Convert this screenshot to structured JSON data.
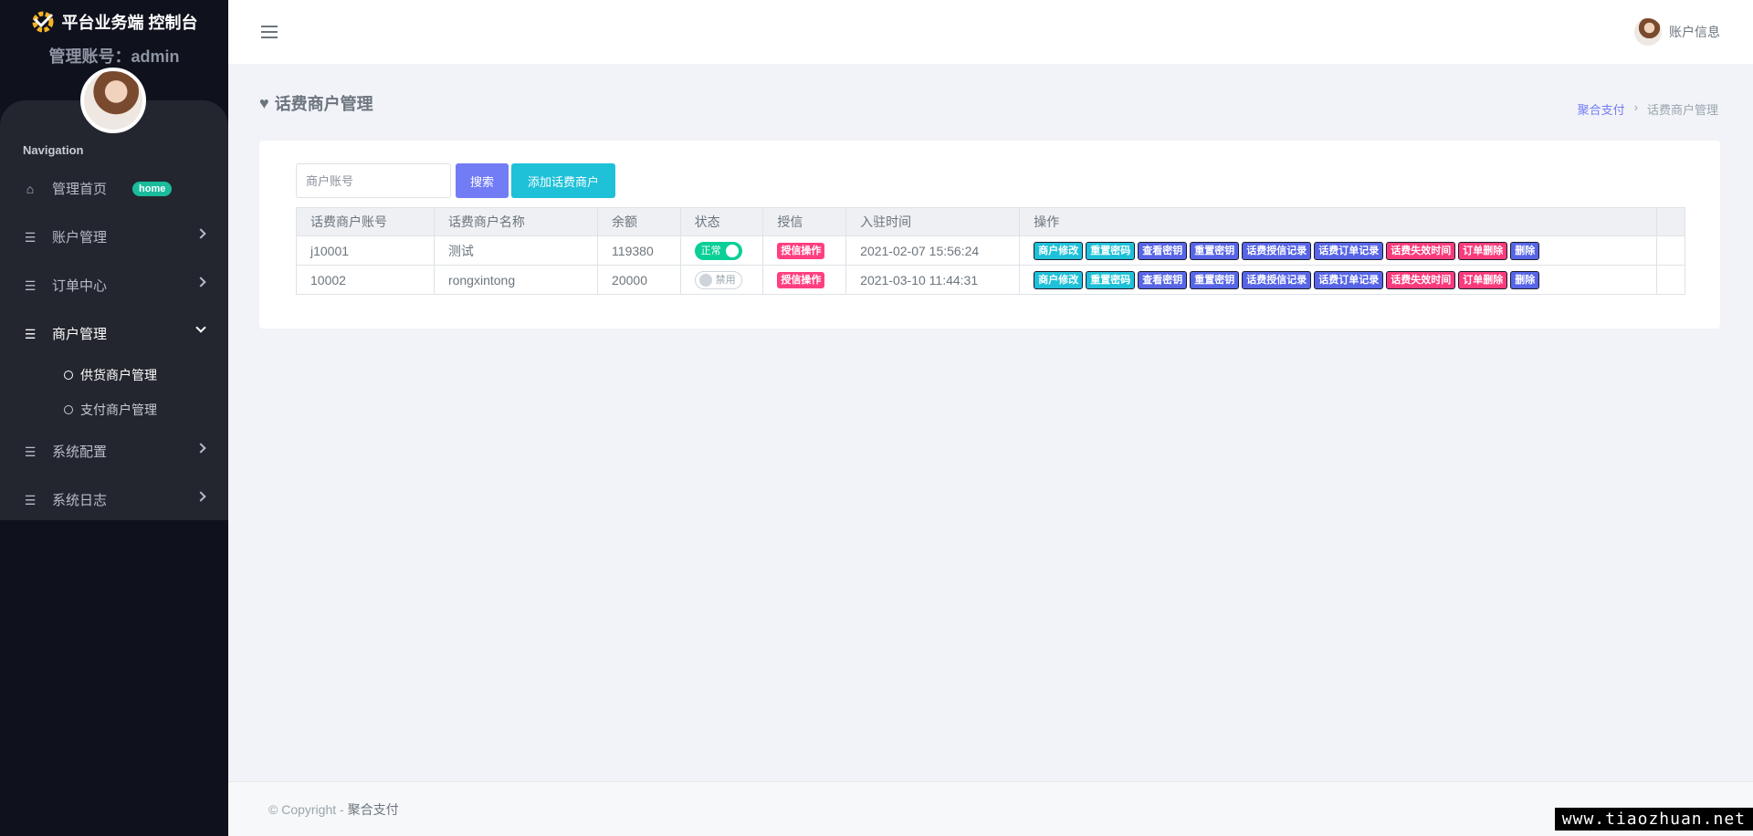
{
  "brand": {
    "title": "平台业务端 控制台",
    "account_line": "管理账号：admin"
  },
  "nav": {
    "caption": "Navigation",
    "home": {
      "label": "管理首页",
      "badge": "home"
    },
    "account": "账户管理",
    "orders": "订单中心",
    "merchant": "商户管理",
    "merchant_sub": [
      "供货商户管理",
      "支付商户管理"
    ],
    "system_config": "系统配置",
    "system_log": "系统日志"
  },
  "topbar": {
    "account_info": "账户信息"
  },
  "page": {
    "title": "话费商户管理",
    "heart_icon": "♥"
  },
  "breadcrumb": {
    "root": "聚合支付",
    "sep": "›",
    "current": "话费商户管理"
  },
  "search": {
    "placeholder": "商户账号",
    "search_label": "搜索",
    "add_label": "添加话费商户"
  },
  "table": {
    "headers": [
      "话费商户账号",
      "话费商户名称",
      "余额",
      "状态",
      "授信",
      "入驻时间",
      "操作"
    ],
    "rows": [
      {
        "account": "j10001",
        "name": "测试",
        "balance": "119380",
        "status": "正常",
        "status_on": true,
        "credit": "授信操作",
        "time": "2021-02-07 15:56:24"
      },
      {
        "account": "10002",
        "name": "rongxintong",
        "balance": "20000",
        "status": "禁用",
        "status_on": false,
        "credit": "授信操作",
        "time": "2021-03-10 11:44:31"
      }
    ],
    "ops": [
      "商户修改",
      "重置密码",
      "查看密钥",
      "重置密钥",
      "话费授信记录",
      "话费订单记录",
      "话费失效时间",
      "订单删除",
      "删除"
    ]
  },
  "footer": {
    "copyright": "© Copyright - ",
    "link": "聚合支付"
  },
  "watermark": "www.tiaozhuan.net",
  "colors": {
    "sidebar": "#0f111c",
    "primary": "#727cf5",
    "info": "#1ec1d8",
    "success": "#0acf97",
    "pink": "#fa3b7b"
  }
}
